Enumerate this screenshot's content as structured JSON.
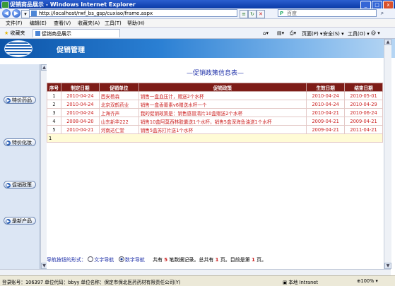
{
  "window": {
    "title": "促销商品展示 - Windows Internet Explorer",
    "buttons": {
      "minimize": "_",
      "maximize": "□",
      "close": "x"
    }
  },
  "address_bar": {
    "back_icon": "back-arrow-icon",
    "forward_icon": "forward-arrow-icon",
    "url": "http://localhost/rwf_bs_gsp/cuxiao/frame.aspx",
    "search_placeholder": "百度",
    "search_engine_icon": "magnifier-icon"
  },
  "menu": {
    "items": [
      "文件(F)",
      "编辑(E)",
      "查看(V)",
      "收藏夹(A)",
      "工具(T)",
      "帮助(H)"
    ]
  },
  "favorites_bar": {
    "favorites_label": "收藏夹",
    "tab_label": "促销商品展示",
    "commands": [
      "页面(P) ▾",
      "安全(S) ▾",
      "工具(O) ▾",
      "@ ▾"
    ]
  },
  "banner": {
    "title": "促销管理"
  },
  "sidebar": {
    "items": [
      {
        "label": "特价药品"
      },
      {
        "label": "特价化妆"
      },
      {
        "label": "促销政策"
      },
      {
        "label": "是新产品"
      }
    ]
  },
  "content": {
    "title": "—促销政策信息表—",
    "table": {
      "headers": [
        "序号",
        "制定日期",
        "促销单位",
        "促销政策",
        "生效日期",
        "结束日期"
      ],
      "rows": [
        [
          "1",
          "2010-04-24",
          "西安杨森",
          "销售一盒血压计，赠送2个水杯",
          "2010-04-24",
          "2010-05-01"
        ],
        [
          "2",
          "2010-04-24",
          "北京双鹤药业",
          "销售一盒香薷素v6赠送水杯一个",
          "2010-04-24",
          "2010-04-29"
        ],
        [
          "3",
          "2010-04-24",
          "上海齐声",
          "我的促销政策是：销售感冒清片10盒赠送2个水杯",
          "2010-04-21",
          "2010-06-24"
        ],
        [
          "4",
          "2008-04-20",
          "山东新华222",
          "销售10盒阿莫西林胶囊送1个水杯，销售5盒深海鱼油送1个水杯",
          "2009-04-21",
          "2009-04-21"
        ],
        [
          "5",
          "2010-04-21",
          "河南达仁堂",
          "销售5盒苏打片送1个水杯",
          "2009-04-21",
          "2011-04-21"
        ]
      ],
      "footer": "1"
    },
    "pager": {
      "label": "导航按钮的形式：",
      "option_text": "文字导航",
      "option_number": "数字导航",
      "prefix": "共有",
      "record_count": "5",
      "mid1": "笔数据记录。总共有",
      "page_count": "1",
      "mid2": "页。目前是第",
      "current_page": "1",
      "suffix": "页。"
    }
  },
  "status_bar": {
    "text": "登录账号：106397   单位代码：bbyy   单位名称：保定市保北医药药材有限责任公司(Y)",
    "zone": "本地 Intranet",
    "zoom": "100%"
  }
}
